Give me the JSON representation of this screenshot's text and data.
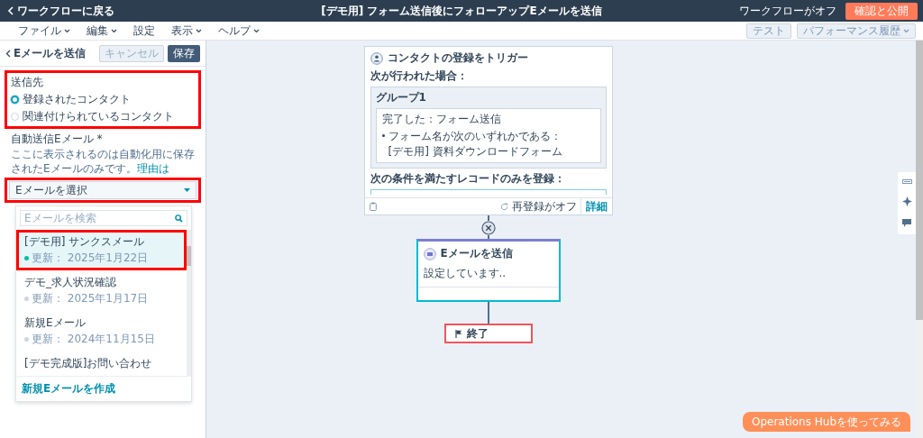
{
  "topbar": {
    "back": "ワークフローに戻る",
    "title": "[デモ用] フォーム送信後にフォローアップEメールを送信",
    "status": "ワークフローがオフ",
    "publish": "確認と公開"
  },
  "menu": [
    {
      "label": "ファイル",
      "has_menu": true
    },
    {
      "label": "編集",
      "has_menu": true
    },
    {
      "label": "設定",
      "has_menu": false
    },
    {
      "label": "表示",
      "has_menu": true
    },
    {
      "label": "ヘルプ",
      "has_menu": true
    }
  ],
  "menu_right": {
    "test": "テスト",
    "history": "パフォーマンス履歴"
  },
  "panel": {
    "title": "Eメールを送信",
    "cancel": "キャンセル",
    "save": "保存",
    "recipients": {
      "label": "送信先",
      "highlighted": true,
      "options": [
        {
          "label": "登録されたコンタクト",
          "selected": true
        },
        {
          "label": "関連付けられているコンタクト",
          "selected": false
        }
      ]
    },
    "email_label": "自動送信Eメール *",
    "help": "ここに表示されるのは自動化用に保存されたEメールのみです。",
    "help_link": "理由は",
    "email_select": {
      "value": "Eメールを選択",
      "highlighted": true
    },
    "search": {
      "placeholder": "Eメールを検索"
    },
    "emails": [
      {
        "name": "[デモ用] サンクスメール",
        "updated": "更新： 2025年1月22日",
        "color": "#00bda5",
        "selected": true,
        "highlighted": true
      },
      {
        "name": "デモ_求人状況確認",
        "updated": "更新： 2025年1月17日",
        "color": "#cbd6e2",
        "selected": false,
        "highlighted": false
      },
      {
        "name": "新規Eメール",
        "updated": "更新： 2024年11月15日",
        "color": "#cbd6e2",
        "selected": false,
        "highlighted": false
      },
      {
        "name": "[デモ完成版]お問い合わせ",
        "selected": false,
        "highlighted": false
      }
    ],
    "create": "新規Eメールを作成"
  },
  "trigger": {
    "title": "コンタクトの登録をトリガー",
    "when": "次が行われた場合：",
    "group": "グループ1",
    "condition": "完了した：フォーム送信",
    "filter": "フォーム名が次のいずれかである：",
    "form": "[デモ用] 資料ダウンロードフォーム",
    "only": "次の条件を満たすレコードのみを登録：",
    "reenroll": "再登録がオフ",
    "details": "詳細"
  },
  "action": {
    "title": "Eメールを送信",
    "body": "設定しています..",
    "selected": true
  },
  "end_node": {
    "label": "終了",
    "highlighted": true
  },
  "promo": "Operations Hubを使ってみる"
}
